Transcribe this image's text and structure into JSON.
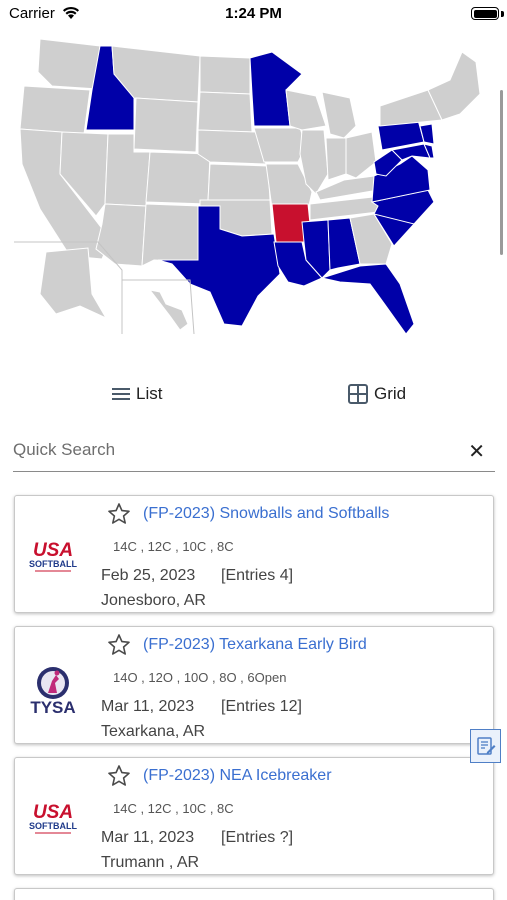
{
  "status_bar": {
    "carrier": "Carrier",
    "time": "1:24 PM"
  },
  "map": {
    "colors": {
      "default": "#cfcfcf",
      "highlight_blue": "#0000a8",
      "highlight_red": "#c8102e",
      "border": "#ffffff"
    }
  },
  "view_toggle": {
    "list_label": "List",
    "grid_label": "Grid"
  },
  "search": {
    "placeholder": "Quick Search",
    "value": ""
  },
  "events": [
    {
      "title": "(FP-2023) Snowballs and Softballs",
      "divisions": "14C ,  12C ,  10C ,  8C",
      "date": "Feb 25, 2023",
      "entries": "[Entries 4]",
      "location": "Jonesboro, AR",
      "logo": "usa-softball-logo",
      "logo_text_1": "USA",
      "logo_text_2": "SOFTBALL"
    },
    {
      "title": "(FP-2023) Texarkana Early Bird",
      "divisions": "14O ,  12O ,  10O ,  8O ,  6Open",
      "date": "Mar 11, 2023",
      "entries": "[Entries 12]",
      "location": "Texarkana, AR",
      "logo": "tysa-logo",
      "logo_text_1": "TYSA"
    },
    {
      "title": "(FP-2023) NEA Icebreaker",
      "divisions": "14C ,  12C ,  10C ,  8C",
      "date": "Mar 11, 2023",
      "entries": "[Entries ?]",
      "location": "Trumann , AR",
      "logo": "usa-softball-logo",
      "logo_text_1": "USA",
      "logo_text_2": "SOFTBALL"
    }
  ],
  "accent": "#3a6fd0"
}
